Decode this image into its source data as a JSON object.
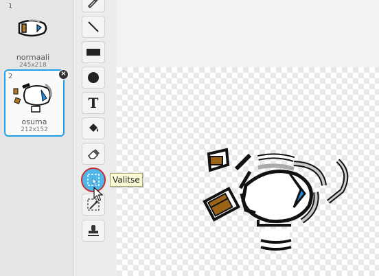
{
  "costumes": [
    {
      "number": "1",
      "name": "normaali",
      "size": "245x218",
      "selected": false
    },
    {
      "number": "2",
      "name": "osuma",
      "size": "212x152",
      "selected": true,
      "delete_label": "×"
    }
  ],
  "tools": [
    {
      "name": "brush",
      "icon": "brush-icon"
    },
    {
      "name": "line",
      "icon": "line-icon"
    },
    {
      "name": "rectangle",
      "icon": "rectangle-icon"
    },
    {
      "name": "ellipse",
      "icon": "ellipse-icon"
    },
    {
      "name": "text",
      "icon": "text-icon",
      "glyph": "T"
    },
    {
      "name": "fill",
      "icon": "paint-bucket-icon"
    },
    {
      "name": "eraser",
      "icon": "eraser-icon"
    },
    {
      "name": "select",
      "icon": "select-icon",
      "active": true
    },
    {
      "name": "magic-select",
      "icon": "magic-wand-icon"
    },
    {
      "name": "stamp",
      "icon": "stamp-icon"
    }
  ],
  "tooltip": {
    "text": "Valitse"
  },
  "colors": {
    "accent": "#1ea1e8",
    "active_tool": "#4fb6ec",
    "highlight_ring": "#cc2b2b"
  }
}
